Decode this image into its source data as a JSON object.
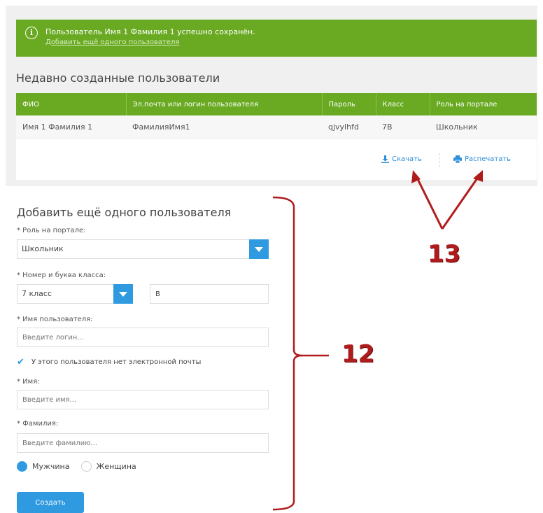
{
  "alert": {
    "message": "Пользователь Имя 1 Фамилия 1 успешно сохранён.",
    "link": "Добавить ещё одного пользователя",
    "icon": "info-icon"
  },
  "recent": {
    "title": "Недавно созданные пользователи",
    "columns": [
      "ФИО",
      "Эл.почта или логин пользователя",
      "Пароль",
      "Класс",
      "Роль на портале"
    ],
    "rows": [
      [
        "Имя 1 Фамилия 1",
        "ФамилияИмя1",
        "qjvylhfd",
        "7В",
        "Школьник"
      ]
    ],
    "download_label": "Скачать",
    "print_label": "Распечатать"
  },
  "form": {
    "title": "Добавить ещё одного пользователя",
    "role_label": "* Роль на портале:",
    "role_value": "Школьник",
    "class_label": "* Номер и буква класса:",
    "class_number": "7 класс",
    "class_letter": "В",
    "username_label": "* Имя пользователя:",
    "username_placeholder": "Введите логин...",
    "no_email_label": "У этого пользователя нет электронной почты",
    "firstname_label": "* Имя:",
    "firstname_placeholder": "Введите имя...",
    "lastname_label": "* Фамилия:",
    "lastname_placeholder": "Введите фамилию...",
    "gender_male": "Мужчина",
    "gender_female": "Женщина",
    "submit_label": "Создать"
  },
  "annotations": {
    "label_12": "12",
    "label_13": "13"
  },
  "colors": {
    "green": "#6aaa23",
    "blue": "#2f9ae0",
    "annotation_red": "#b01c1c"
  }
}
